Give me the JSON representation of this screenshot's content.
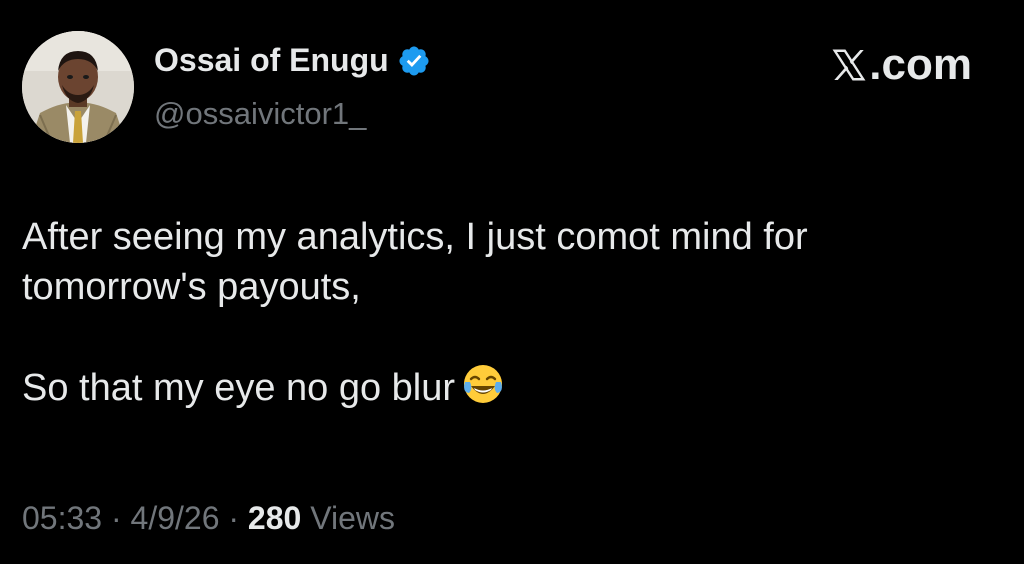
{
  "author": {
    "name": "Ossai of Enugu",
    "handle": "@ossaivictor1_",
    "verified_color": "#1d9bf0",
    "avatar_icon": "profile-photo"
  },
  "brand": {
    "label": ".com",
    "logo_icon": "x-logo-icon"
  },
  "tweet": {
    "line1": "After seeing my analytics, I just comot mind for",
    "line2": "tomorrow's payouts,",
    "line3": "So that my eye no go blur",
    "emoji_icon": "face-with-tears-of-joy-icon"
  },
  "meta": {
    "time": "05:33",
    "separator1": " · ",
    "date": "4/9/26",
    "separator2": " · ",
    "views_count": "280",
    "views_label": " Views"
  },
  "colors": {
    "background": "#000000",
    "primary_text": "#e7e9ea",
    "secondary_text": "#71767b",
    "verified": "#1d9bf0"
  }
}
